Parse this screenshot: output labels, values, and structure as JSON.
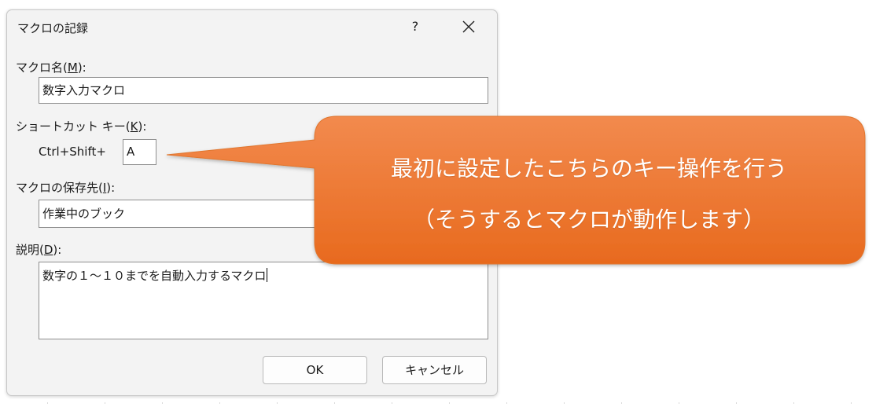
{
  "dialog": {
    "title": "マクロの記録",
    "help_label": "?",
    "macro_name": {
      "label_pre": "マクロ名(",
      "accel": "M",
      "label_post": "):",
      "value": "数字入力マクロ"
    },
    "shortcut": {
      "label_pre": "ショートカット キー(",
      "accel": "K",
      "label_post": "):",
      "prefix": "Ctrl+Shift+",
      "key_value": "A"
    },
    "store_in": {
      "label_pre": "マクロの保存先(",
      "accel": "I",
      "label_post": "):",
      "selected": "作業中のブック"
    },
    "description": {
      "label_pre": "説明(",
      "accel": "D",
      "label_post": "):",
      "value": "数字の１～１０までを自動入力するマクロ"
    },
    "ok_label": "OK",
    "cancel_label": "キャンセル"
  },
  "callout": {
    "line1": "最初に設定したこちらのキー操作を行う",
    "line2": "（そうするとマクロが動作します）",
    "color_top": "#f28a4e",
    "color_bottom": "#e86a1e"
  }
}
